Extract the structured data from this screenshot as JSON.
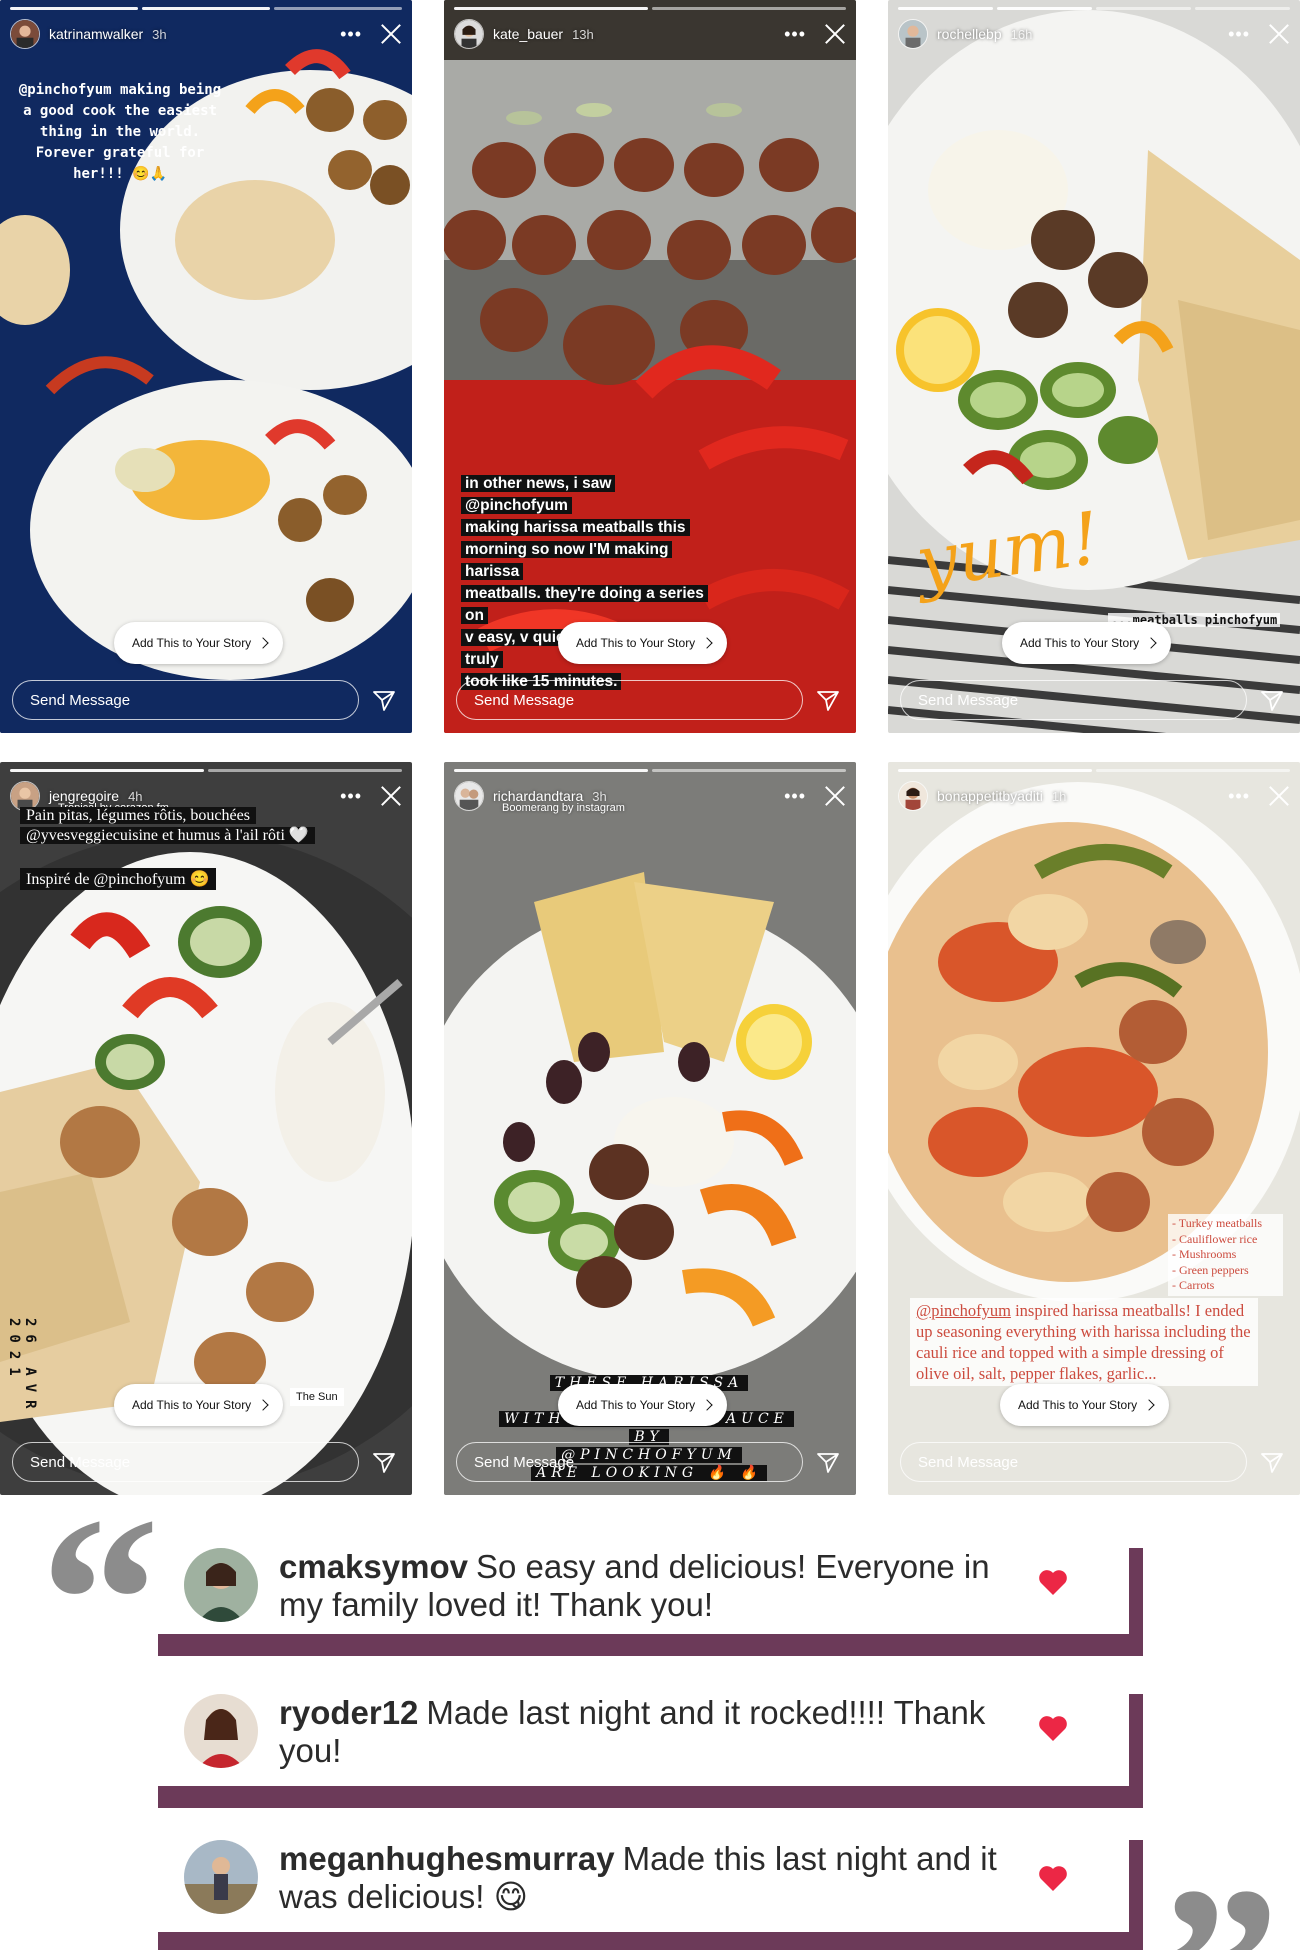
{
  "colors": {
    "frame": "#6c3a59",
    "heart": "#ec2745",
    "quote": "#8c8c8c",
    "caption_red": "#cc4b3e",
    "yum": "#f4a21a"
  },
  "common": {
    "add_story_label": "Add This to Your Story",
    "send_message_placeholder": "Send Message",
    "more_icon": "more-options-icon",
    "close_icon": "close-icon"
  },
  "stories": [
    {
      "username": "katrinamwalker",
      "time": "3h",
      "caption_lines": [
        "@pinchofyum making being",
        "a good cook the easiest",
        "thing in the world.",
        "Forever grateful for",
        "her!!! 😊🙏"
      ]
    },
    {
      "username": "kate_bauer",
      "time": "13h",
      "caption_lines": [
        "in other news, i saw @pinchofyum",
        "making harissa meatballs this",
        "morning so now I'M making harissa",
        "meatballs. they're doing a series on",
        "v easy, v quick SOS meals- this truly",
        "took like 15 minutes."
      ]
    },
    {
      "username": "rochellebp",
      "time": "16h",
      "yum_text": "yum!",
      "tag_text": "...meatballs pinchofyum"
    },
    {
      "username": "jengregoire",
      "time": "4h",
      "music": "Tropical by corazon.fm",
      "caption_a": "Pain pitas, légumes rôtis, bouchées @yvesveggiecuisine et humus à l'ail rôti 🤍",
      "caption_b": "Inspiré de @pinchofyum 😊",
      "date_stamp": "26 AVR 2021",
      "sticker": "The Sun"
    },
    {
      "username": "richardandtara",
      "time": "3h",
      "boomerang": "Boomerang by instagram",
      "caption_lines": [
        "THESE HARISSA MEATBALLS",
        "WITH A HARISSA SAUCE BY",
        "@PINCHOFYUM",
        "ARE LOOKING 🔥 🔥"
      ]
    },
    {
      "username": "bonappetitbyaditi",
      "time": "1h",
      "list_items": [
        "- Turkey meatballs",
        "- Cauliflower rice",
        "- Mushrooms",
        "- Green peppers",
        "- Carrots"
      ],
      "caption_handle": "@pinchofyum",
      "caption_rest": " inspired harissa meatballs! I ended up seasoning everything with harissa including the cauli rice and topped with a simple dressing of olive oil, salt, pepper flakes, garlic..."
    }
  ],
  "reviews": [
    {
      "user": "cmaksymov",
      "text": "So easy and delicious! Everyone in my family loved it! Thank you!"
    },
    {
      "user": "ryoder12",
      "text": "Made last night and it rocked!!!! Thank you!"
    },
    {
      "user": "meganhughesmurray",
      "text": "Made this last night and it was delicious! 😋"
    }
  ]
}
